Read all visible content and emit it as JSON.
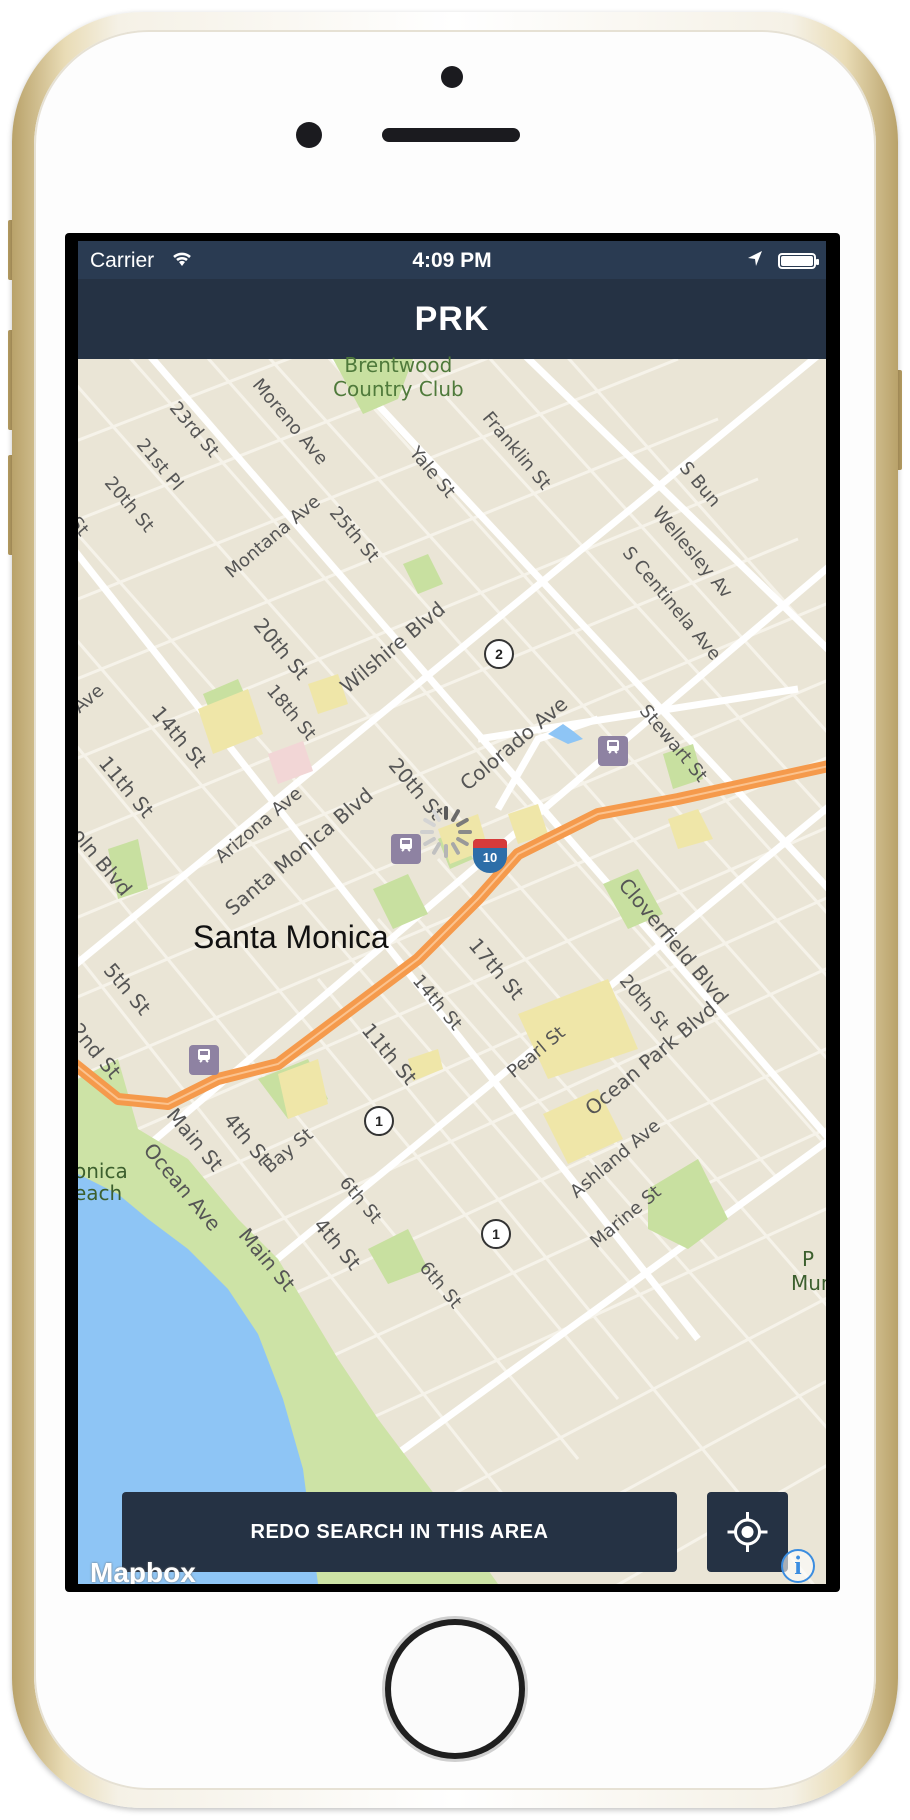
{
  "status_bar": {
    "carrier": "Carrier",
    "time": "4:09 PM",
    "wifi_icon": "wifi-icon",
    "location_icon": "location-arrow-icon",
    "battery_icon": "battery-icon"
  },
  "nav": {
    "title": "PRK"
  },
  "map": {
    "city_label": "Santa Monica",
    "park_labels": {
      "brentwood": "Brentwood\nCountry Club",
      "beach_1": "onica",
      "beach_2": "each",
      "right_park_1": "P",
      "right_park_2": "Mun"
    },
    "streets": {
      "s_23rd": "23rd St",
      "s_21st_pl": "21st Pl",
      "s_20th_top": "20th St",
      "s_st_left": "St",
      "s_moreno": "Moreno Ave",
      "s_yale": "Yale St",
      "s_franklin": "Franklin St",
      "s_bundy": "S Bun",
      "s_wellesley": "Wellesley Av",
      "s_centinela": "S Centinela Ave",
      "s_montana": "Montana Ave",
      "s_25th": "25th St",
      "s_20th_mid": "20th St",
      "s_wilshire": "Wilshire Blvd",
      "s_18th": "18th St",
      "s_14th": "14th St",
      "s_ave_left": "Ave",
      "s_11th": "11th St",
      "s_colorado": "Colorado Ave",
      "s_stewart": "Stewart St",
      "s_20th_lower": "20th St",
      "s_arizona": "Arizona Ave",
      "s_santa_monica_blvd": "Santa Monica Blvd",
      "s_lincoln": "oln Blvd",
      "s_cloverfield": "Cloverfield Blvd",
      "s_17th": "17th St",
      "s_14th_lower": "14th St",
      "s_20th_right": "20th St",
      "s_5th": "5th St",
      "s_2nd": "2nd St",
      "s_11th_lower": "11th St",
      "s_pearl": "Pearl St",
      "s_ocean_park": "Ocean Park Blvd",
      "s_main": "Main St",
      "s_4th": "4th St",
      "s_ocean_ave": "Ocean Ave",
      "s_bay": "Bay St",
      "s_6th": "6th St",
      "s_4th_lower": "4th St",
      "s_main_lower": "Main St",
      "s_6th_lower": "6th St",
      "s_ashland": "Ashland Ave",
      "s_marine": "Marine St"
    },
    "route_shields": {
      "r2": "2",
      "r1a": "1",
      "r1b": "1",
      "i10": "10"
    },
    "transit_icon": "train-icon"
  },
  "buttons": {
    "redo_search": "REDO SEARCH IN THIS AREA",
    "locate_icon": "crosshair-icon"
  },
  "attribution": {
    "logo": "Mapbox",
    "info": "i"
  },
  "colors": {
    "nav": "#253244",
    "status": "#2a3b52",
    "map_land": "#eae5d6",
    "freeway": "#f59a4c",
    "water": "#8ec5f5",
    "park": "#c8e0a0",
    "accent_info": "#3b8de0"
  }
}
